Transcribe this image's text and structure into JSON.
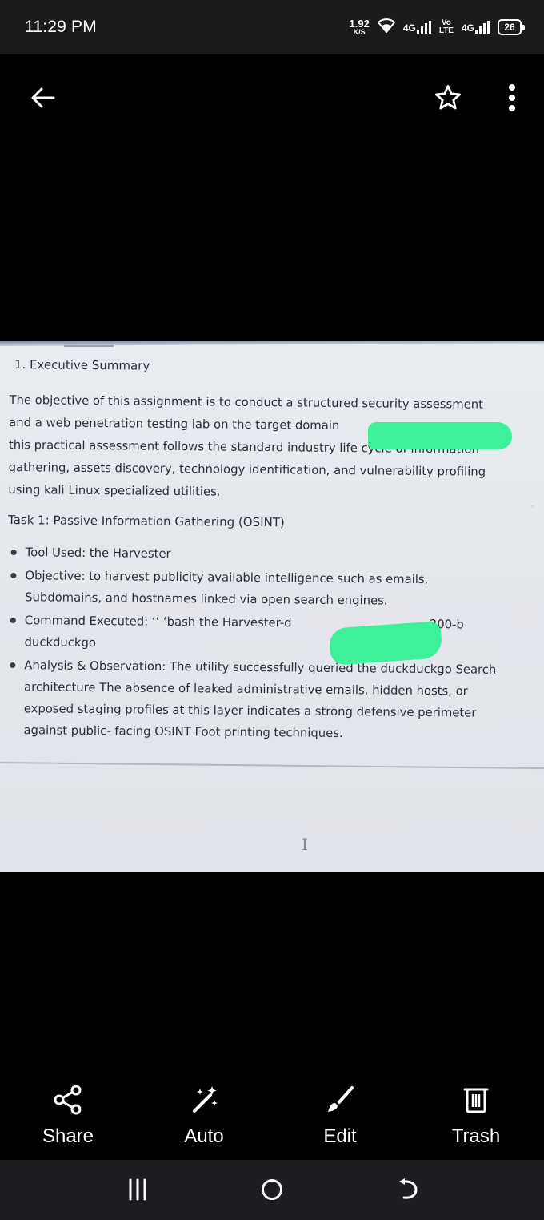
{
  "status_bar": {
    "time": "11:29 PM",
    "net_speed_value": "1.92",
    "net_speed_unit": "K/S",
    "network_1": "4G",
    "volte_top": "Vo",
    "volte_bottom": "LTE",
    "network_2": "4G",
    "battery": "26"
  },
  "toolbar": {
    "back_icon": "arrow-left-icon",
    "favorite_icon": "star-outline-icon",
    "more_icon": "more-vertical-icon"
  },
  "document": {
    "section_heading": "1. Executive Summary",
    "intro_lines": [
      "The objective of this assignment is to conduct a structured security assessment",
      "and a web penetration testing lab on the target domain",
      "this practical assessment follows the standard industry life cycle of information",
      "gathering, assets discovery, technology identification, and vulnerability profiling",
      "using kali Linux specialized utilities."
    ],
    "task_heading": "Task 1: Passive Information Gathering (OSINT)",
    "bullets": [
      {
        "lines": [
          "Tool Used: the Harvester"
        ]
      },
      {
        "lines": [
          "Objective: to harvest publicity available intelligence such as emails,",
          "Subdomains, and hostnames linked via open search engines."
        ]
      },
      {
        "lines": [
          "Command Executed: ‘‘ ‘bash the  Harvester-d",
          "duckduckgo"
        ],
        "tail": "200-b"
      },
      {
        "lines": [
          "Analysis & Observation: The utility successfully queried the duckduckgo Search",
          "architecture The absence of leaked administrative emails, hidden hosts, or",
          "exposed staging profiles at this layer indicates a strong defensive perimeter",
          "against public- facing OSINT Foot printing techniques."
        ]
      }
    ],
    "cursor_glyph": "I",
    "redaction_color": "#3ff09a"
  },
  "actions": [
    {
      "label": "Share",
      "icon": "share-icon"
    },
    {
      "label": "Auto",
      "icon": "magic-wand-icon"
    },
    {
      "label": "Edit",
      "icon": "brush-icon"
    },
    {
      "label": "Trash",
      "icon": "trash-icon"
    }
  ],
  "navbar": {
    "recents_icon": "recents-icon",
    "home_icon": "home-icon",
    "back_icon": "nav-back-icon"
  }
}
